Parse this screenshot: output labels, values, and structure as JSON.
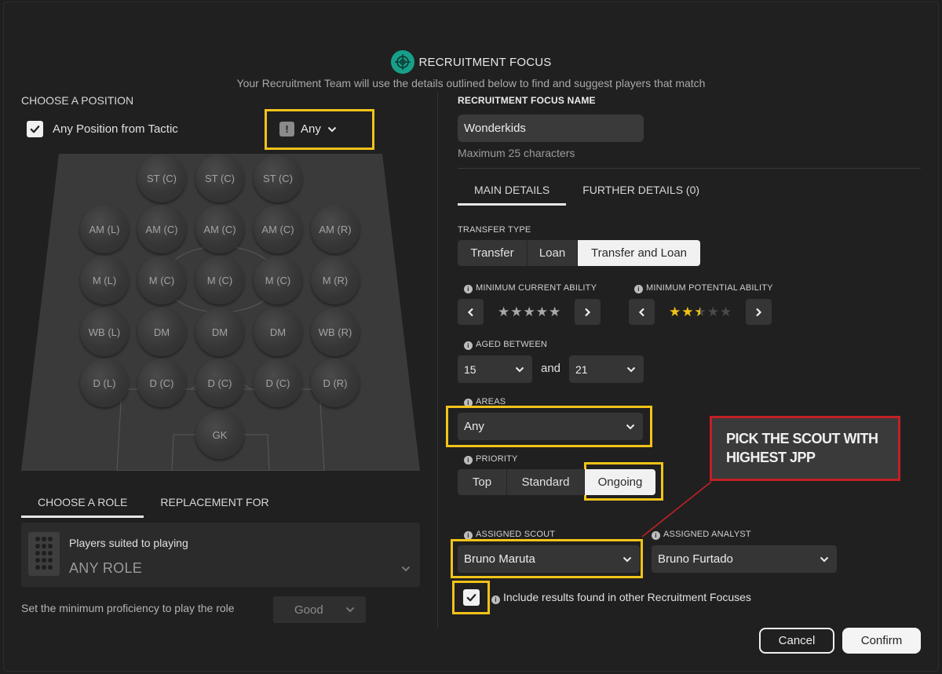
{
  "header": {
    "icon": "target-icon",
    "title": "RECRUITMENT FOCUS",
    "subtitle": "Your Recruitment Team will use the details outlined below to find and suggest players that match"
  },
  "position": {
    "section_label": "CHOOSE A POSITION",
    "any_position_label": "Any Position from Tactic",
    "any_position_checked": true,
    "filter_value": "Any",
    "slots": [
      "ST (C)",
      "ST (C)",
      "ST (C)",
      "AM (L)",
      "AM (C)",
      "AM (C)",
      "AM (C)",
      "AM (R)",
      "M (L)",
      "M (C)",
      "M (C)",
      "M (C)",
      "M (R)",
      "WB (L)",
      "DM",
      "DM",
      "DM",
      "WB (R)",
      "D (L)",
      "D (C)",
      "D (C)",
      "D (C)",
      "D (R)",
      "GK"
    ]
  },
  "role": {
    "tabs": [
      "CHOOSE A ROLE",
      "REPLACEMENT FOR"
    ],
    "line1": "Players suited to playing",
    "line2": "ANY ROLE",
    "proficiency_label": "Set the minimum proficiency to play the role",
    "proficiency_value": "Good"
  },
  "focus": {
    "name_label": "RECRUITMENT FOCUS NAME",
    "name_value": "Wonderkids",
    "name_hint": "Maximum 25 characters",
    "tabs": [
      "MAIN DETAILS",
      "FURTHER DETAILS (0)"
    ],
    "transfer_type_label": "TRANSFER TYPE",
    "transfer_options": [
      "Transfer",
      "Loan",
      "Transfer and Loan"
    ],
    "transfer_selected": "Transfer and Loan",
    "min_ca_label": "MINIMUM CURRENT ABILITY",
    "min_ca_stars": 0,
    "min_pa_label": "MINIMUM POTENTIAL ABILITY",
    "min_pa_stars": 2.5,
    "aged_label": "AGED BETWEEN",
    "age_from": "15",
    "age_and": "and",
    "age_to": "21",
    "areas_label": "AREAS",
    "areas_value": "Any",
    "priority_label": "PRIORITY",
    "priority_options": [
      "Top",
      "Standard",
      "Ongoing"
    ],
    "priority_selected": "Ongoing",
    "scout_label": "ASSIGNED SCOUT",
    "scout_value": "Bruno Maruta",
    "analyst_label": "ASSIGNED ANALYST",
    "analyst_value": "Bruno Furtado",
    "include_label": "Include results found in other Recruitment Focuses",
    "include_checked": true
  },
  "annotation": {
    "note": "PICK THE SCOUT WITH HIGHEST JPP",
    "highlight_color": "#f2c318",
    "note_border_color": "#c22026"
  },
  "buttons": {
    "cancel": "Cancel",
    "confirm": "Confirm"
  }
}
